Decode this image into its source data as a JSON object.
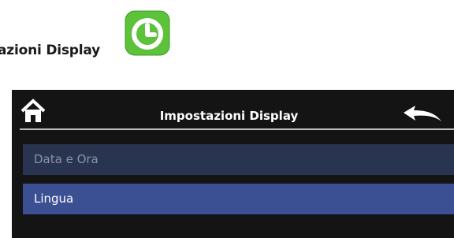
{
  "heading": "azioni Display",
  "screen": {
    "title": "Impostazioni Display",
    "menu": [
      {
        "label": "Data e Ora",
        "state": "disabled"
      },
      {
        "label": "Lingua",
        "state": "selected"
      }
    ]
  },
  "colors": {
    "screen_bg": "#141414",
    "item_disabled_bg": "#283450",
    "item_selected_bg": "#3b4f93",
    "app_icon_green": "#5cc23a"
  },
  "icons": {
    "app": "clock-icon",
    "home": "home-icon",
    "back": "back-arrow-icon"
  }
}
